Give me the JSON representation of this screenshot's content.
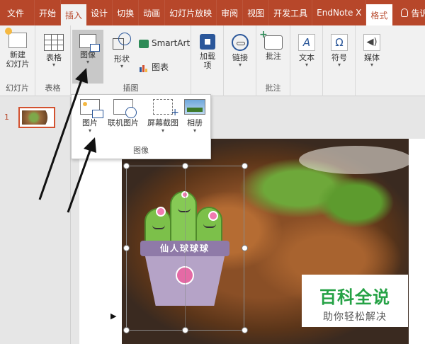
{
  "tabs": {
    "file": "文件",
    "home": "开始",
    "insert": "插入",
    "design": "设计",
    "transitions": "切换",
    "animations": "动画",
    "slideshow": "幻灯片放映",
    "review": "审阅",
    "view": "视图",
    "developer": "开发工具",
    "endnote": "EndNote X",
    "format": "格式",
    "tell_me": "告诉我"
  },
  "ribbon": {
    "slides": {
      "new_slide_line1": "新建",
      "new_slide_line2": "幻灯片",
      "group": "幻灯片"
    },
    "tables": {
      "table": "表格",
      "group": "表格"
    },
    "illustrations": {
      "images": "图像",
      "shapes": "形状",
      "smartart": "SmartArt",
      "chart": "图表",
      "group": "插图"
    },
    "addins": {
      "addins_line1": "加载",
      "addins_line2": "项"
    },
    "links": {
      "link": "链接"
    },
    "comments": {
      "comment": "批注",
      "group": "批注"
    },
    "text": {
      "text": "文本",
      "glyph": "A"
    },
    "symbols": {
      "symbol": "符号",
      "glyph": "Ω"
    },
    "media": {
      "media": "媒体"
    }
  },
  "image_menu": {
    "picture": "图片",
    "online_picture": "联机图片",
    "screenshot": "屏幕截图",
    "album": "相册",
    "footer": "图像"
  },
  "thumbnails": {
    "slide_number": "1"
  },
  "sticker": {
    "text": "仙人球球球"
  },
  "watermark": {
    "title": "百科全说",
    "subtitle": "助你轻松解决"
  },
  "colors": {
    "accent": "#b7472a",
    "ribbon_bg": "#f1f1f1",
    "watermark_green": "#25a245"
  }
}
